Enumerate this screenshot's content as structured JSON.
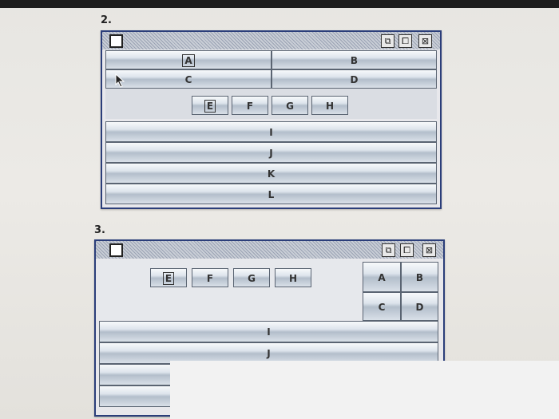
{
  "labels": {
    "two": "2.",
    "three": "3."
  },
  "window2": {
    "controls": {
      "minimize": "⧉",
      "maximize": "⧠",
      "close": "⊠"
    },
    "row_top": [
      "A",
      "B"
    ],
    "row_mid": [
      "C",
      "D"
    ],
    "center_buttons": [
      "E",
      "F",
      "G",
      "H"
    ],
    "rows": [
      "I",
      "J",
      "K",
      "L"
    ]
  },
  "window3": {
    "controls": {
      "minimize": "⧉",
      "maximize": "⧠",
      "close": "⊠"
    },
    "left_buttons": [
      "E",
      "F",
      "G",
      "H"
    ],
    "grid": [
      "A",
      "B",
      "C",
      "D"
    ],
    "rows": [
      "I",
      "J",
      "",
      ""
    ]
  },
  "colors": {
    "window_border": "#2b3e7a",
    "titlebar": "#b9bec8"
  }
}
